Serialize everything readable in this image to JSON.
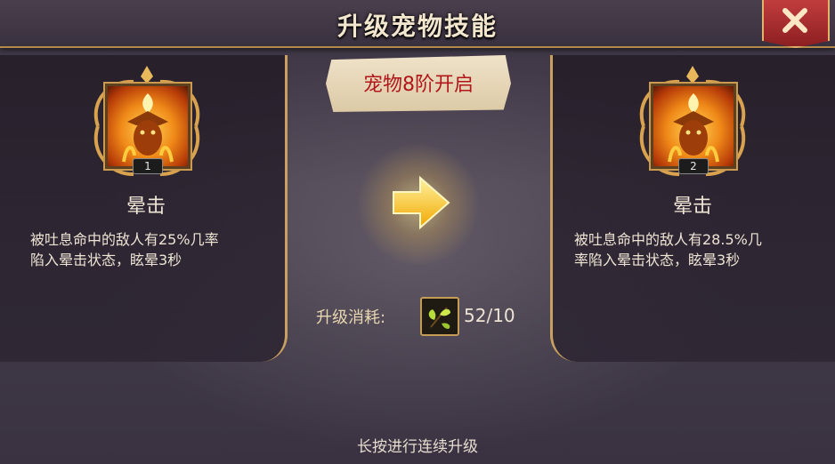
{
  "header": {
    "title": "升级宠物技能",
    "close_icon": "close-x-icon"
  },
  "unlock_banner": "宠物8阶开启",
  "current_skill": {
    "icon": "flame-demon-skill-icon",
    "level": "1",
    "name": "晕击",
    "description_line1": "被吐息命中的敌人有25%几率",
    "description_line2": "陷入晕击状态，眩晕3秒"
  },
  "next_skill": {
    "icon": "flame-demon-skill-icon",
    "level": "2",
    "name": "晕击",
    "description_line1": "被吐息命中的敌人有28.5%几",
    "description_line2": "率陷入晕击状态，眩晕3秒"
  },
  "upgrade": {
    "arrow_icon": "arrow-right-icon",
    "cost_label": "升级消耗:",
    "cost_item_icon": "herb-leaf-icon",
    "cost_value": "52/10"
  },
  "hint": "长按进行连续升级",
  "colors": {
    "title_text": "#f3e6cf",
    "gold_border": "#caa060",
    "banner_text": "#b0161a",
    "close_button": "#c23d3d",
    "arrow": "#ffd21a"
  }
}
